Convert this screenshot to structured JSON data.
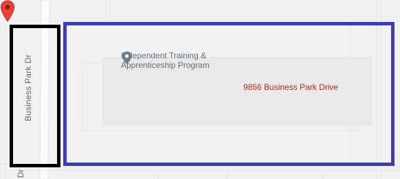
{
  "map": {
    "road_name": "Business Park Dr",
    "road_name_fragment": "Dr",
    "poi": {
      "icon": "location-pin-icon",
      "name_line1": "Independent Training &",
      "name_line2": "Apprenticeship Program",
      "color": "#5f6f79"
    },
    "marker": {
      "icon": "red-map-pin-icon",
      "address": "9856 Business Park Drive",
      "color": "#ea4335"
    },
    "highlights": [
      {
        "name": "road-highlight",
        "color": "#000000"
      },
      {
        "name": "building-highlight",
        "color": "#3d3dba"
      }
    ]
  }
}
